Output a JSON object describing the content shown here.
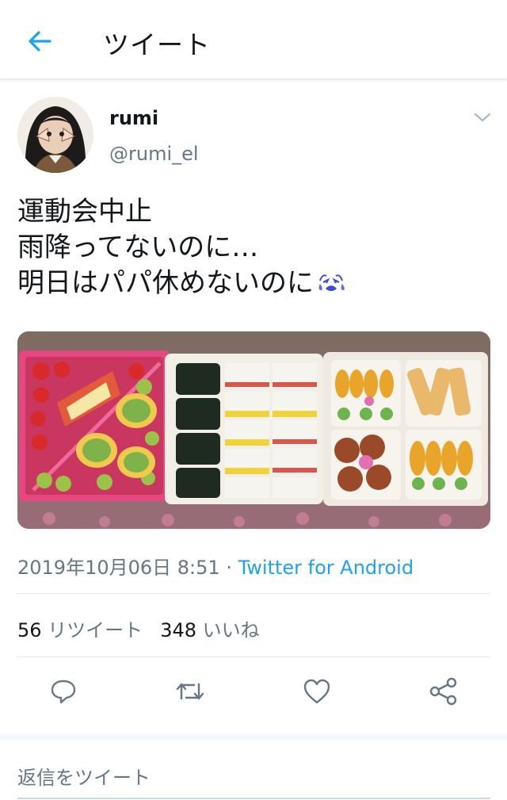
{
  "header": {
    "title": "ツイート",
    "back_icon": "arrow-left-icon",
    "accent_color": "#1da1f2"
  },
  "tweet": {
    "author": {
      "name": "rumi",
      "handle": "@rumi_el",
      "avatar_icon": "avatar-image"
    },
    "menu_icon": "chevron-down-icon",
    "text_lines": [
      "運動会中止",
      "雨降ってないのに…",
      "明日はパパ休めないのに"
    ],
    "text_emoji": "weary-crying-emoji",
    "media_alt_icon": "bento-photo",
    "timestamp": "2019年10月06日 8:51",
    "separator": " · ",
    "source": "Twitter for Android",
    "stats": {
      "retweets_count": "56",
      "retweets_label": "リツイート",
      "likes_count": "348",
      "likes_label": "いいね"
    },
    "actions": [
      {
        "name": "reply",
        "icon": "reply-icon"
      },
      {
        "name": "retweet",
        "icon": "retweet-icon"
      },
      {
        "name": "like",
        "icon": "heart-icon"
      },
      {
        "name": "share",
        "icon": "share-icon"
      }
    ]
  },
  "reply": {
    "placeholder": "返信をツイート"
  }
}
